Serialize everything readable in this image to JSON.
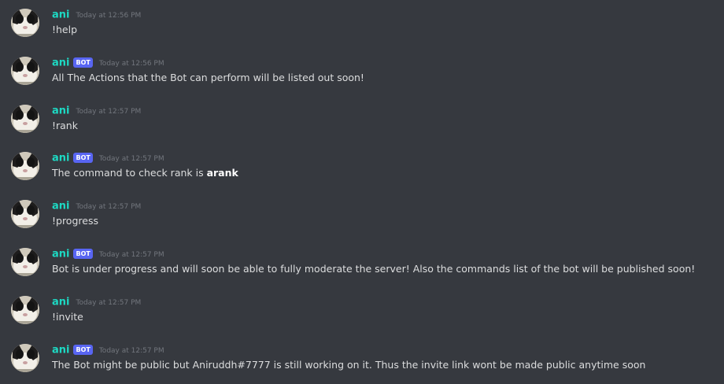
{
  "colors": {
    "background": "#36393f",
    "username": "#1dd9c3",
    "bot_badge": "#5865f2",
    "timestamp": "#72767d",
    "message_text": "#dcddde"
  },
  "messages": [
    {
      "author": "ani",
      "is_bot": false,
      "badge": "",
      "timestamp": "Today at 12:56 PM",
      "text": "!help",
      "bold": ""
    },
    {
      "author": "ani",
      "is_bot": true,
      "badge": "BOT",
      "timestamp": "Today at 12:56 PM",
      "text": "All The Actions that the Bot can perform will be listed out soon!",
      "bold": ""
    },
    {
      "author": "ani",
      "is_bot": false,
      "badge": "",
      "timestamp": "Today at 12:57 PM",
      "text": "!rank",
      "bold": ""
    },
    {
      "author": "ani",
      "is_bot": true,
      "badge": "BOT",
      "timestamp": "Today at 12:57 PM",
      "text": "The command to check rank is ",
      "bold": "arank"
    },
    {
      "author": "ani",
      "is_bot": false,
      "badge": "",
      "timestamp": "Today at 12:57 PM",
      "text": "!progress",
      "bold": ""
    },
    {
      "author": "ani",
      "is_bot": true,
      "badge": "BOT",
      "timestamp": "Today at 12:57 PM",
      "text": "Bot is under progress and will soon be able to fully moderate the server! Also the commands list of the bot will be published soon!",
      "bold": ""
    },
    {
      "author": "ani",
      "is_bot": false,
      "badge": "",
      "timestamp": "Today at 12:57 PM",
      "text": "!invite",
      "bold": ""
    },
    {
      "author": "ani",
      "is_bot": true,
      "badge": "BOT",
      "timestamp": "Today at 12:57 PM",
      "text": "The Bot might be public but Aniruddh#7777 is still working on it. Thus the invite link wont be made public anytime soon",
      "bold": ""
    }
  ]
}
